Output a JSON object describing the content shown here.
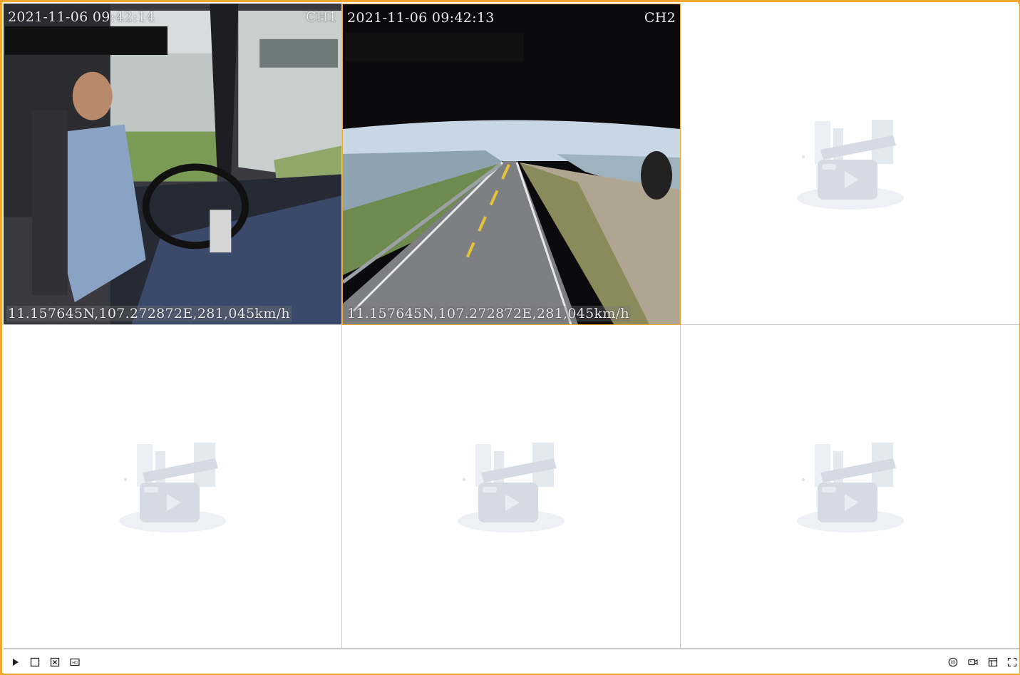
{
  "channels": [
    {
      "timestamp": "2021-11-06 09:42:14",
      "channel_label": "CH1",
      "gps": "11.157645N,107.272872E,281,045km/h",
      "state": "playing"
    },
    {
      "timestamp": "2021-11-06 09:42:13",
      "channel_label": "CH2",
      "gps": "11.157645N,107.272872E,281,045km/h",
      "state": "playing"
    },
    {
      "state": "empty"
    },
    {
      "state": "empty"
    },
    {
      "state": "empty"
    },
    {
      "state": "empty"
    }
  ],
  "colors": {
    "accent": "#f0a830",
    "divider": "#c8c8c8",
    "placeholder": "#dfe3ec"
  },
  "controls": {
    "left": [
      "play-icon",
      "stop-icon",
      "close-all-icon",
      "hd-icon"
    ],
    "right": [
      "pause-circle-icon",
      "record-icon",
      "layout-icon",
      "fullscreen-icon"
    ],
    "hd_label": "HD"
  }
}
